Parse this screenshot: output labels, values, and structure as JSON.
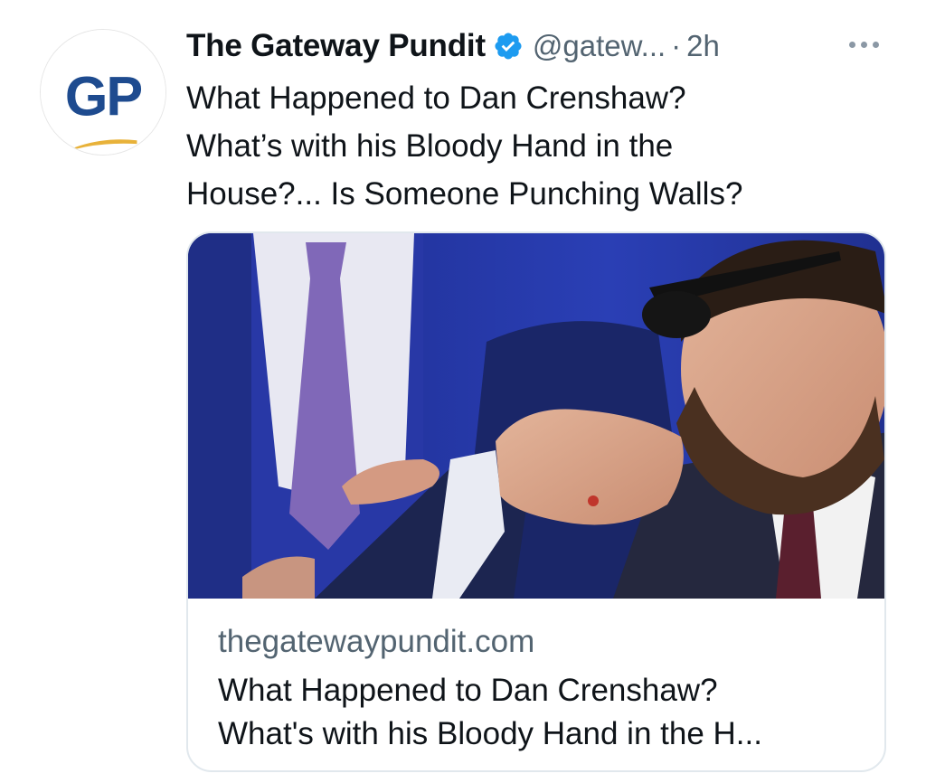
{
  "account": {
    "display_name": "The Gateway Pundit",
    "handle": "@gatew...",
    "separator": "·",
    "time": "2h",
    "avatar_text": "GP",
    "verified_icon": "verified-badge-icon",
    "verified_color": "#1d9bf0"
  },
  "tweet": {
    "text_lines": [
      "What Happened to Dan Crenshaw?",
      "What’s with his Bloody Hand in the",
      "House?... Is Someone Punching Walls?"
    ]
  },
  "card": {
    "domain": "thegatewaypundit.com",
    "title_lines": [
      "What Happened to Dan Crenshaw?",
      "What's with his Bloody Hand in the H..."
    ]
  },
  "colors": {
    "text_primary": "#0f1419",
    "text_secondary": "#536471",
    "brand_blue": "#1e4b8f",
    "brand_gold": "#e8b23a"
  }
}
